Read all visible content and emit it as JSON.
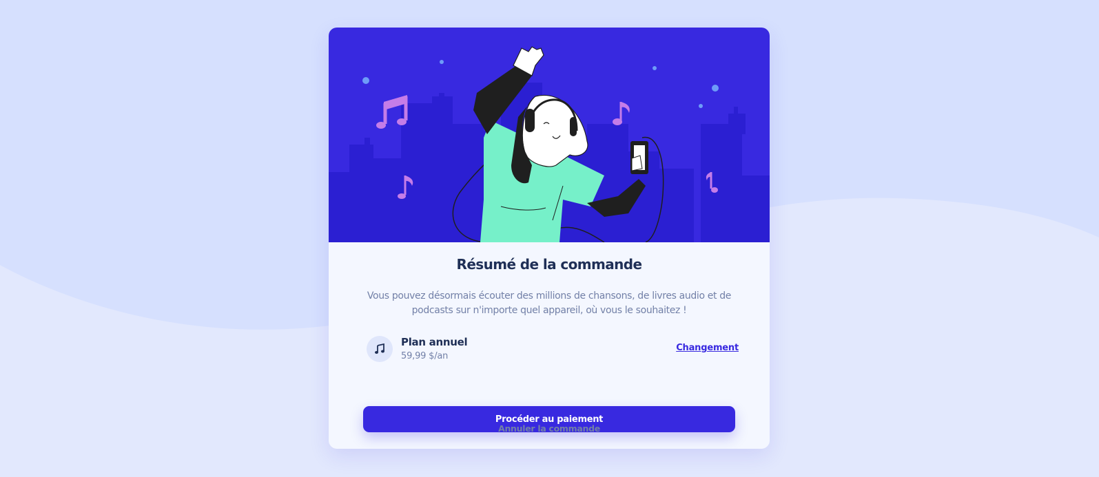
{
  "colors": {
    "page_bg": "#d6e0fe",
    "wave": "#e2e8fd",
    "card_bg": "#f4f7ff",
    "hero_bg": "#3829e0",
    "buildings": "#2b1fd2",
    "primary": "#3829e0",
    "heading": "#1f2f56",
    "muted": "#7280a7",
    "shirt": "#76f0c9",
    "notes": "#c57de8"
  },
  "hero": {
    "illustration": "dancing-person-with-headphones-illustration"
  },
  "summary": {
    "title": "Résumé de la commande",
    "description": "Vous pouvez désormais écouter des millions de chansons, de livres audio et de podcasts sur n'importe quel appareil, où vous le souhaitez !"
  },
  "plan": {
    "icon": "music-note-icon",
    "name": "Plan annuel",
    "price": "59,99 $/an",
    "change_label": "Changement"
  },
  "actions": {
    "pay_label": "Procéder au paiement",
    "cancel_label": "Annuler la commande"
  }
}
